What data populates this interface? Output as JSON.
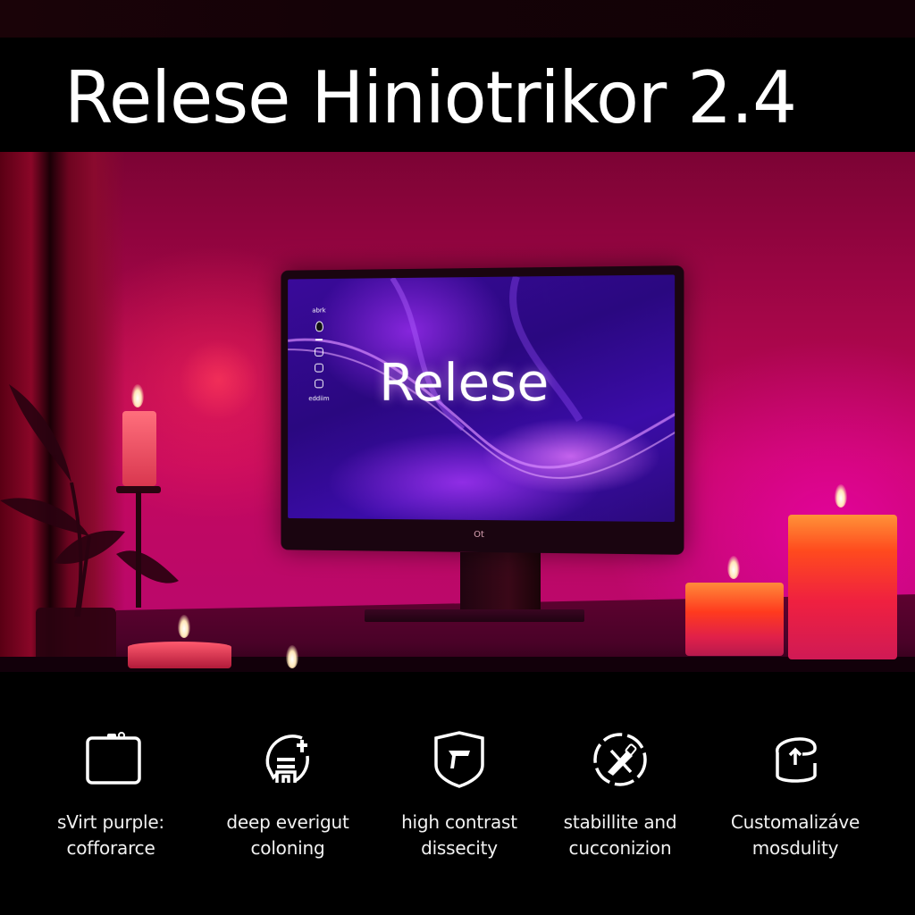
{
  "header": {
    "title": "Relese Hiniotrikor 2.4"
  },
  "scene": {
    "monitor": {
      "screen_title": "Relese",
      "side_label_top": "abrk",
      "side_label_bottom": "eddiim",
      "logo": "Ot"
    },
    "colors": {
      "wall": "#c2085e",
      "screen": "#3a0a9a",
      "accent_purple": "#b43cff",
      "candle": "#ff4a1e"
    }
  },
  "features": [
    {
      "icon": "folder-icon",
      "line1": "sVirt purple:",
      "line2": "cofforarce"
    },
    {
      "icon": "refresh-stack-icon",
      "line1": "deep everigut",
      "line2": "coloning"
    },
    {
      "icon": "shield-f-icon",
      "line1": "high contrast",
      "line2": "dissecity"
    },
    {
      "icon": "pen-cycle-icon",
      "line1": "stabillite and",
      "line2": "cucconizion"
    },
    {
      "icon": "upload-container-icon",
      "line1": "Customalizáve",
      "line2": "mosdulity"
    }
  ]
}
